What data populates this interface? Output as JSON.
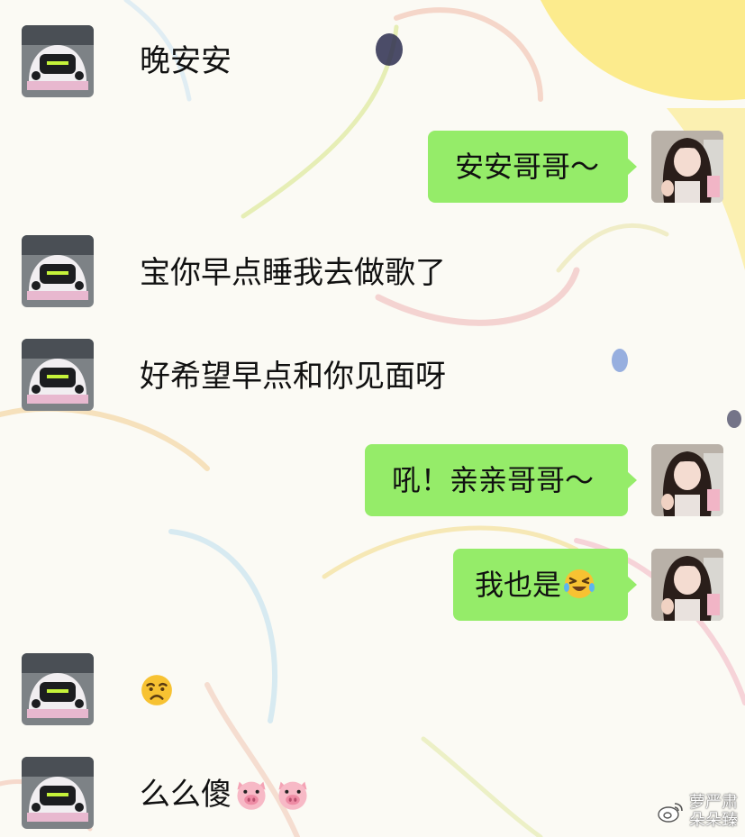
{
  "chat": {
    "messages": [
      {
        "side": "left",
        "text": "晚安安"
      },
      {
        "side": "right",
        "text": "安安哥哥～"
      },
      {
        "side": "left",
        "text": "宝你早点睡我去做歌了"
      },
      {
        "side": "left",
        "text": "好希望早点和你见面呀"
      },
      {
        "side": "right",
        "text": "吼！亲亲哥哥～"
      },
      {
        "side": "right",
        "text": "我也是",
        "emoji": "laughing-crying-face"
      },
      {
        "side": "left",
        "text": "",
        "emoji": "sad-face"
      },
      {
        "side": "left",
        "text": "么么傻",
        "emoji": "pig-face-x2"
      }
    ]
  },
  "watermark": {
    "handle": "萝严肃",
    "sub": "朵朵臻",
    "icon": "weibo-icon"
  },
  "colors": {
    "bubble_right": "#95ec69",
    "background": "#fbfaf4"
  }
}
